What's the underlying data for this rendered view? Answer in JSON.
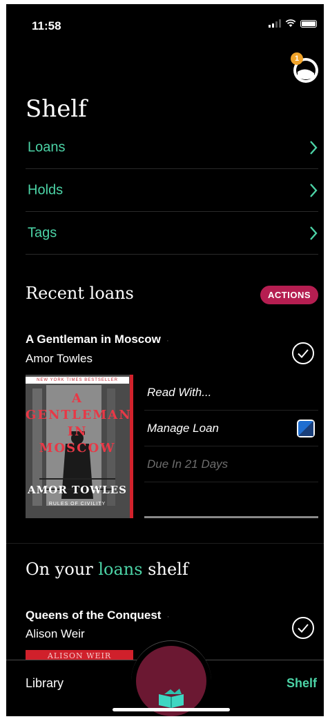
{
  "status_bar": {
    "time": "11:58"
  },
  "header": {
    "notification_count": "1",
    "title": "Shelf"
  },
  "nav": {
    "items": [
      {
        "label": "Loans"
      },
      {
        "label": "Holds"
      },
      {
        "label": "Tags"
      }
    ]
  },
  "recent_loans": {
    "title": "Recent loans",
    "actions_label": "ACTIONS",
    "book": {
      "title": "A Gentleman in Moscow",
      "separator": "·",
      "author": "Amor Towles",
      "cover": {
        "banner": "NEW YORK TIMES BESTSELLER",
        "line1": "A",
        "line2": "GENTLEMAN",
        "line3": "IN",
        "line4": "MOSCOW",
        "author": "AMOR TOWLES",
        "subtitle": "RULES OF CIVILITY"
      },
      "actions": [
        {
          "label": "Read With..."
        },
        {
          "label": "Manage Loan"
        },
        {
          "label": "Due In 21 Days"
        }
      ]
    }
  },
  "loans_shelf": {
    "title_before": "On your ",
    "title_accent": "loans",
    "title_after": " shelf",
    "book": {
      "title": "Queens of the Conquest",
      "separator": "·",
      "author": "Alison Weir",
      "cover_text": "ALISON WEIR"
    }
  },
  "tabbar": {
    "library_label": "Library",
    "shelf_label": "Shelf"
  },
  "colors": {
    "accent": "#4cd3a6",
    "actions_pill": "#b51e51",
    "center_button": "#6b1832",
    "badge": "#f0a32a"
  }
}
